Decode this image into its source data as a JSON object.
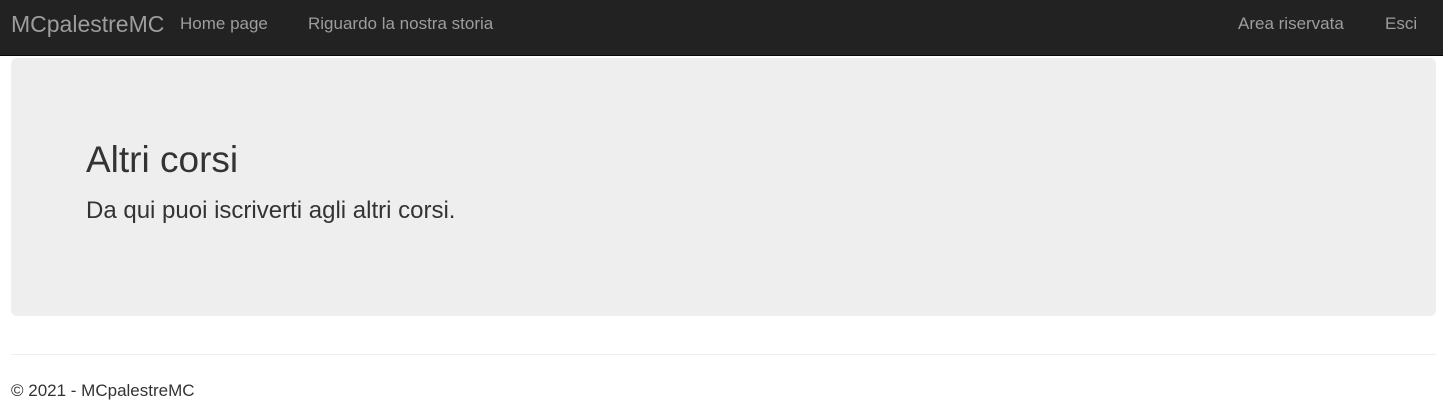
{
  "navbar": {
    "brand": "MCpalestreMC",
    "left_links": [
      {
        "label": "Home page"
      },
      {
        "label": "Riguardo la nostra storia"
      }
    ],
    "right_links": [
      {
        "label": "Area riservata"
      },
      {
        "label": "Esci"
      }
    ]
  },
  "main": {
    "title": "Altri corsi",
    "lead": "Da qui puoi iscriverti agli altri corsi."
  },
  "footer": {
    "text": "© 2021 - MCpalestreMC"
  },
  "colors": {
    "navbar_background": "#222222",
    "navbar_text": "#9d9d9d",
    "jumbotron_background": "#eeeeee",
    "body_text": "#333333"
  }
}
